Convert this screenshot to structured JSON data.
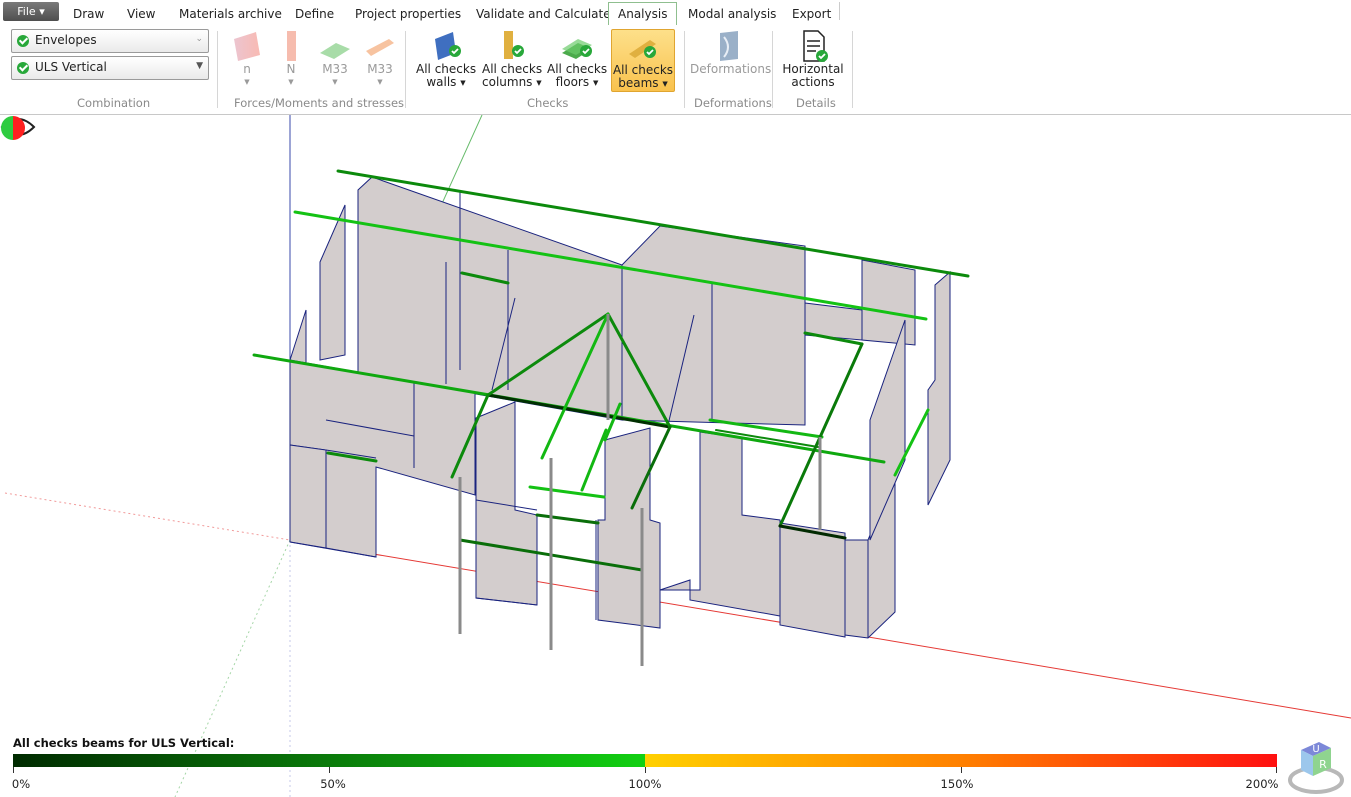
{
  "menu": {
    "file_label": "File",
    "tabs": [
      "Draw",
      "View",
      "Materials archive",
      "Define",
      "Project properties",
      "Validate and Calculate",
      "Analysis",
      "Modal analysis",
      "Export"
    ],
    "active_tab": "Analysis"
  },
  "ribbon": {
    "combination": {
      "label": "Combination",
      "envelope": "Envelopes",
      "combo": "ULS Vertical"
    },
    "forces": {
      "label": "Forces/Moments and stresses",
      "items": [
        "n",
        "N",
        "M33",
        "M33"
      ]
    },
    "checks": {
      "label": "Checks",
      "walls": {
        "line1": "All checks",
        "line2": "walls"
      },
      "columns": {
        "line1": "All checks",
        "line2": "columns"
      },
      "floors": {
        "line1": "All checks",
        "line2": "floors"
      },
      "beams": {
        "line1": "All checks",
        "line2": "beams"
      }
    },
    "deformations": {
      "label": "Deformations",
      "button": "Deformations"
    },
    "details": {
      "label": "Details",
      "line1": "Horizontal",
      "line2": "actions"
    }
  },
  "legend": {
    "title": "All checks beams for ULS Vertical:",
    "ticks": [
      "0%",
      "50%",
      "100%",
      "150%",
      "200%"
    ]
  },
  "navcube": {
    "face_top": "U",
    "face_front": "R"
  },
  "colors": {
    "accent_tab_border": "#8fbf8f",
    "selected_button": "#f9c24e",
    "wall_fill": "#d2cccc",
    "wall_edge": "#1a237e"
  }
}
